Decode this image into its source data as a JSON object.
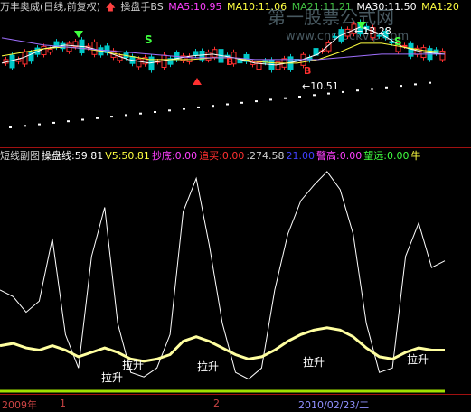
{
  "top_header": {
    "title": "万丰奥威(日线,前复权)",
    "signal_label": "操盘手BS",
    "ma5": "MA5:10.95",
    "ma10": "MA10:11.06",
    "ma21": "MA21:11.21",
    "ma30": "MA30:11.50",
    "ma": "MA1:20",
    "colors": {
      "title": "#d0d0d0",
      "signal": "#ff4040",
      "ma5": "#ff40ff",
      "ma10": "#ffff40",
      "ma21": "#40c040",
      "ma30": "#ffffff",
      "ma": "#ffff40"
    }
  },
  "watermark": {
    "line1": "第一股票公式网",
    "line2": "www.cnstockvip.com"
  },
  "sub_header": {
    "title": "短线副图",
    "items": [
      {
        "text": "操盘线:59.81",
        "color": "#ffffff"
      },
      {
        "text": "V5:50.81",
        "color": "#ffff40"
      },
      {
        "text": "抄底:0.00",
        "color": "#ff40ff"
      },
      {
        "text": "追买:0.00",
        "color": "#ff3030"
      },
      {
        "text": ":274.58",
        "color": "#d0d0d0"
      },
      {
        "text": "21.00",
        "color": "#4040ff"
      },
      {
        "text": "警高:0.00",
        "color": "#ff40ff"
      },
      {
        "text": "望远:0.00",
        "color": "#40ff40"
      },
      {
        "text": "牛",
        "color": "#ffff40"
      }
    ]
  },
  "price_annotations": {
    "high": "13.28",
    "low": "10.51",
    "signal_s": "S",
    "signal_b": "B"
  },
  "time_axis": {
    "left_label": "2009年",
    "mark1": "1",
    "mark2": "2",
    "date": "2010/02/23/二"
  },
  "chart_data": [
    {
      "type": "line",
      "title": "万丰奥威(日线,前复权)",
      "series": [
        {
          "name": "MA5",
          "values": [
            11.0,
            11.3,
            11.8,
            12.0,
            11.9,
            11.6,
            11.2,
            11.0,
            11.2,
            11.4,
            11.5,
            11.3,
            11.0,
            10.9,
            11.1,
            11.5,
            12.5,
            13.0,
            12.6,
            11.9,
            11.6,
            11.5
          ]
        },
        {
          "name": "MA10",
          "values": [
            11.4,
            11.6,
            11.8,
            11.9,
            11.8,
            11.6,
            11.4,
            11.2,
            11.2,
            11.2,
            11.3,
            11.3,
            11.1,
            11.0,
            11.0,
            11.2,
            11.6,
            12.1,
            12.1,
            11.9,
            11.7,
            11.6
          ]
        },
        {
          "name": "MA30",
          "values": [
            12.4,
            12.2,
            12.0,
            11.9,
            11.8,
            11.7,
            11.6,
            11.5,
            11.4,
            11.3,
            11.3,
            11.3,
            11.2,
            11.2,
            11.2,
            11.2,
            11.3,
            11.4,
            11.5,
            11.5,
            11.5,
            11.5
          ]
        }
      ],
      "ylim": [
        9.5,
        14.0
      ]
    },
    {
      "type": "line",
      "title": "短线副图",
      "series": [
        {
          "name": "操盘线",
          "values": [
            45,
            42,
            35,
            40,
            68,
            25,
            10,
            60,
            82,
            30,
            8,
            6,
            10,
            25,
            80,
            95,
            65,
            30,
            8,
            5,
            10,
            45,
            70,
            85,
            92,
            98,
            90,
            70,
            30,
            8,
            10,
            60,
            75,
            55,
            58
          ]
        },
        {
          "name": "V5",
          "values": [
            20,
            21,
            19,
            18,
            20,
            18,
            15,
            17,
            19,
            17,
            14,
            13,
            14,
            16,
            22,
            24,
            22,
            19,
            16,
            14,
            15,
            18,
            22,
            25,
            27,
            28,
            27,
            24,
            19,
            15,
            14,
            17,
            19,
            18,
            18
          ]
        }
      ],
      "ylim": [
        0,
        100
      ],
      "annotations": [
        "拉升",
        "拉升",
        "拉升",
        "拉升",
        "拉升"
      ]
    }
  ]
}
